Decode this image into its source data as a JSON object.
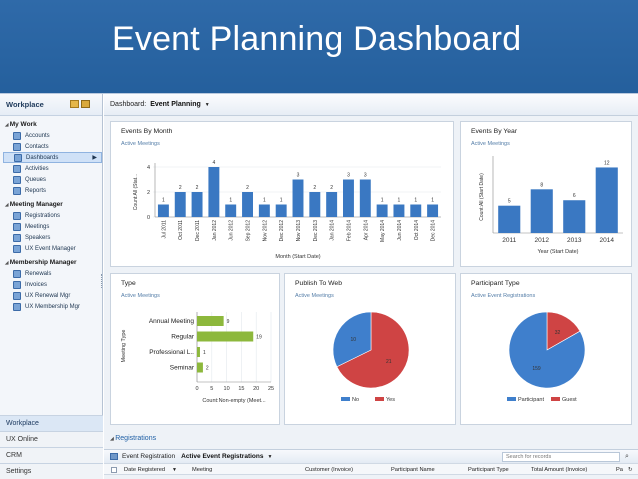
{
  "slide_title": "Event Planning Dashboard",
  "sidebar": {
    "header": "Workplace",
    "sections": [
      {
        "title": "My Work",
        "items": [
          "Accounts",
          "Contacts",
          "Dashboards",
          "Activities",
          "Queues",
          "Reports"
        ],
        "selected": 2
      },
      {
        "title": "Meeting Manager",
        "items": [
          "Registrations",
          "Meetings",
          "Speakers",
          "UX Event Manager"
        ]
      },
      {
        "title": "Membership Manager",
        "items": [
          "Renewals",
          "Invoices",
          "UX Renewal Mgr",
          "UX Membership Mgr"
        ]
      }
    ],
    "areas": [
      "Workplace",
      "UX Online",
      "CRM",
      "Settings"
    ]
  },
  "dashboard": {
    "label": "Dashboard:",
    "value": "Event Planning"
  },
  "panels": {
    "events_by_month": {
      "title": "Events By Month",
      "subtitle": "Active Meetings"
    },
    "events_by_year": {
      "title": "Events By Year",
      "subtitle": "Active Meetings"
    },
    "type": {
      "title": "Type",
      "subtitle": "Active Meetings"
    },
    "publish": {
      "title": "Publish To Web",
      "subtitle": "Active Meetings"
    },
    "participant": {
      "title": "Participant Type",
      "subtitle": "Active Event Registrations"
    }
  },
  "chart_data": [
    {
      "type": "bar",
      "title": "Events By Month",
      "subtitle": "Active Meetings",
      "categories": [
        "Jul 2011",
        "Oct 2011",
        "Dec 2011",
        "Jan 2012",
        "Jun 2012",
        "Sep 2012",
        "Nov 2012",
        "Dec 2012",
        "Nov 2013",
        "Dec 2013",
        "Jan 2014",
        "Feb 2014",
        "Apr 2014",
        "May 2014",
        "Jun 2014",
        "Oct 2014",
        "Dec 2014"
      ],
      "values": [
        1,
        2,
        2,
        4,
        1,
        2,
        1,
        1,
        3,
        2,
        2,
        3,
        3,
        1,
        1,
        1,
        1
      ],
      "xlabel": "Month (Start Date)",
      "ylabel": "Count:All (Stat...",
      "ylim": [
        0,
        4
      ],
      "yticks": [
        0,
        2,
        4
      ],
      "color": "#3a78c2"
    },
    {
      "type": "bar",
      "title": "Events By Year",
      "subtitle": "Active Meetings",
      "categories": [
        "2011",
        "2012",
        "2013",
        "2014"
      ],
      "values": [
        5,
        8,
        6,
        12
      ],
      "xlabel": "Year (Start Date)",
      "ylabel": "Count:All (Start Date)",
      "ylim": [
        0,
        13
      ],
      "color": "#3a78c2"
    },
    {
      "type": "bar",
      "orientation": "horizontal",
      "title": "Type",
      "subtitle": "Active Meetings",
      "categories": [
        "Annual Meeting",
        "Regular",
        "Professional L..",
        "Seminar"
      ],
      "values": [
        9,
        19,
        1,
        2
      ],
      "xlabel": "Count:Non-empty (Meet...",
      "ylabel": "Meeting Type",
      "xlim": [
        0,
        25
      ],
      "xticks": [
        0,
        5,
        10,
        15,
        20,
        25
      ],
      "color": "#8db83c"
    },
    {
      "type": "pie",
      "title": "Publish To Web",
      "subtitle": "Active Meetings",
      "labels": [
        "No",
        "Yes"
      ],
      "values": [
        10,
        21
      ],
      "colors": [
        "#3f7fcc",
        "#cf4444"
      ],
      "legend": "bottom"
    },
    {
      "type": "pie",
      "title": "Participant Type",
      "subtitle": "Active Event Registrations",
      "labels": [
        "Participant",
        "Guest"
      ],
      "values": [
        159,
        32
      ],
      "colors": [
        "#3f7fcc",
        "#cf4444"
      ],
      "legend": "bottom"
    }
  ],
  "registrations": {
    "link": "Registrations",
    "entity": "Event Registration",
    "view": "Active Event Registrations",
    "search_placeholder": "Search for records",
    "columns": [
      "Date Registered",
      "Meeting",
      "Customer (Invoice)",
      "Participant Name",
      "Participant Type",
      "Total Amount (Invoice)",
      "Pa"
    ]
  }
}
